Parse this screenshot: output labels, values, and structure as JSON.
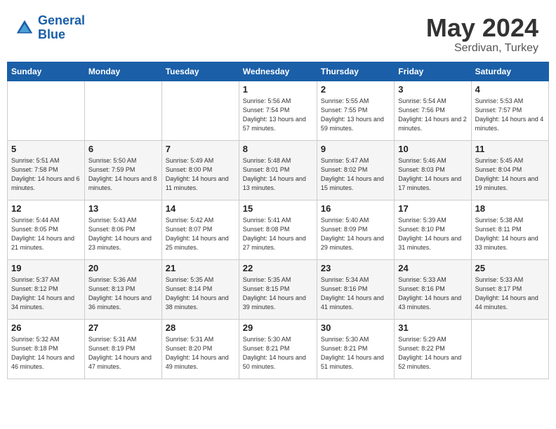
{
  "header": {
    "logo_line1": "General",
    "logo_line2": "Blue",
    "month": "May 2024",
    "location": "Serdivan, Turkey"
  },
  "days_of_week": [
    "Sunday",
    "Monday",
    "Tuesday",
    "Wednesday",
    "Thursday",
    "Friday",
    "Saturday"
  ],
  "weeks": [
    [
      {
        "day": "",
        "sunrise": "",
        "sunset": "",
        "daylight": ""
      },
      {
        "day": "",
        "sunrise": "",
        "sunset": "",
        "daylight": ""
      },
      {
        "day": "",
        "sunrise": "",
        "sunset": "",
        "daylight": ""
      },
      {
        "day": "1",
        "sunrise": "Sunrise: 5:56 AM",
        "sunset": "Sunset: 7:54 PM",
        "daylight": "Daylight: 13 hours and 57 minutes."
      },
      {
        "day": "2",
        "sunrise": "Sunrise: 5:55 AM",
        "sunset": "Sunset: 7:55 PM",
        "daylight": "Daylight: 13 hours and 59 minutes."
      },
      {
        "day": "3",
        "sunrise": "Sunrise: 5:54 AM",
        "sunset": "Sunset: 7:56 PM",
        "daylight": "Daylight: 14 hours and 2 minutes."
      },
      {
        "day": "4",
        "sunrise": "Sunrise: 5:53 AM",
        "sunset": "Sunset: 7:57 PM",
        "daylight": "Daylight: 14 hours and 4 minutes."
      }
    ],
    [
      {
        "day": "5",
        "sunrise": "Sunrise: 5:51 AM",
        "sunset": "Sunset: 7:58 PM",
        "daylight": "Daylight: 14 hours and 6 minutes."
      },
      {
        "day": "6",
        "sunrise": "Sunrise: 5:50 AM",
        "sunset": "Sunset: 7:59 PM",
        "daylight": "Daylight: 14 hours and 8 minutes."
      },
      {
        "day": "7",
        "sunrise": "Sunrise: 5:49 AM",
        "sunset": "Sunset: 8:00 PM",
        "daylight": "Daylight: 14 hours and 11 minutes."
      },
      {
        "day": "8",
        "sunrise": "Sunrise: 5:48 AM",
        "sunset": "Sunset: 8:01 PM",
        "daylight": "Daylight: 14 hours and 13 minutes."
      },
      {
        "day": "9",
        "sunrise": "Sunrise: 5:47 AM",
        "sunset": "Sunset: 8:02 PM",
        "daylight": "Daylight: 14 hours and 15 minutes."
      },
      {
        "day": "10",
        "sunrise": "Sunrise: 5:46 AM",
        "sunset": "Sunset: 8:03 PM",
        "daylight": "Daylight: 14 hours and 17 minutes."
      },
      {
        "day": "11",
        "sunrise": "Sunrise: 5:45 AM",
        "sunset": "Sunset: 8:04 PM",
        "daylight": "Daylight: 14 hours and 19 minutes."
      }
    ],
    [
      {
        "day": "12",
        "sunrise": "Sunrise: 5:44 AM",
        "sunset": "Sunset: 8:05 PM",
        "daylight": "Daylight: 14 hours and 21 minutes."
      },
      {
        "day": "13",
        "sunrise": "Sunrise: 5:43 AM",
        "sunset": "Sunset: 8:06 PM",
        "daylight": "Daylight: 14 hours and 23 minutes."
      },
      {
        "day": "14",
        "sunrise": "Sunrise: 5:42 AM",
        "sunset": "Sunset: 8:07 PM",
        "daylight": "Daylight: 14 hours and 25 minutes."
      },
      {
        "day": "15",
        "sunrise": "Sunrise: 5:41 AM",
        "sunset": "Sunset: 8:08 PM",
        "daylight": "Daylight: 14 hours and 27 minutes."
      },
      {
        "day": "16",
        "sunrise": "Sunrise: 5:40 AM",
        "sunset": "Sunset: 8:09 PM",
        "daylight": "Daylight: 14 hours and 29 minutes."
      },
      {
        "day": "17",
        "sunrise": "Sunrise: 5:39 AM",
        "sunset": "Sunset: 8:10 PM",
        "daylight": "Daylight: 14 hours and 31 minutes."
      },
      {
        "day": "18",
        "sunrise": "Sunrise: 5:38 AM",
        "sunset": "Sunset: 8:11 PM",
        "daylight": "Daylight: 14 hours and 33 minutes."
      }
    ],
    [
      {
        "day": "19",
        "sunrise": "Sunrise: 5:37 AM",
        "sunset": "Sunset: 8:12 PM",
        "daylight": "Daylight: 14 hours and 34 minutes."
      },
      {
        "day": "20",
        "sunrise": "Sunrise: 5:36 AM",
        "sunset": "Sunset: 8:13 PM",
        "daylight": "Daylight: 14 hours and 36 minutes."
      },
      {
        "day": "21",
        "sunrise": "Sunrise: 5:35 AM",
        "sunset": "Sunset: 8:14 PM",
        "daylight": "Daylight: 14 hours and 38 minutes."
      },
      {
        "day": "22",
        "sunrise": "Sunrise: 5:35 AM",
        "sunset": "Sunset: 8:15 PM",
        "daylight": "Daylight: 14 hours and 39 minutes."
      },
      {
        "day": "23",
        "sunrise": "Sunrise: 5:34 AM",
        "sunset": "Sunset: 8:16 PM",
        "daylight": "Daylight: 14 hours and 41 minutes."
      },
      {
        "day": "24",
        "sunrise": "Sunrise: 5:33 AM",
        "sunset": "Sunset: 8:16 PM",
        "daylight": "Daylight: 14 hours and 43 minutes."
      },
      {
        "day": "25",
        "sunrise": "Sunrise: 5:33 AM",
        "sunset": "Sunset: 8:17 PM",
        "daylight": "Daylight: 14 hours and 44 minutes."
      }
    ],
    [
      {
        "day": "26",
        "sunrise": "Sunrise: 5:32 AM",
        "sunset": "Sunset: 8:18 PM",
        "daylight": "Daylight: 14 hours and 46 minutes."
      },
      {
        "day": "27",
        "sunrise": "Sunrise: 5:31 AM",
        "sunset": "Sunset: 8:19 PM",
        "daylight": "Daylight: 14 hours and 47 minutes."
      },
      {
        "day": "28",
        "sunrise": "Sunrise: 5:31 AM",
        "sunset": "Sunset: 8:20 PM",
        "daylight": "Daylight: 14 hours and 49 minutes."
      },
      {
        "day": "29",
        "sunrise": "Sunrise: 5:30 AM",
        "sunset": "Sunset: 8:21 PM",
        "daylight": "Daylight: 14 hours and 50 minutes."
      },
      {
        "day": "30",
        "sunrise": "Sunrise: 5:30 AM",
        "sunset": "Sunset: 8:21 PM",
        "daylight": "Daylight: 14 hours and 51 minutes."
      },
      {
        "day": "31",
        "sunrise": "Sunrise: 5:29 AM",
        "sunset": "Sunset: 8:22 PM",
        "daylight": "Daylight: 14 hours and 52 minutes."
      },
      {
        "day": "",
        "sunrise": "",
        "sunset": "",
        "daylight": ""
      }
    ]
  ]
}
